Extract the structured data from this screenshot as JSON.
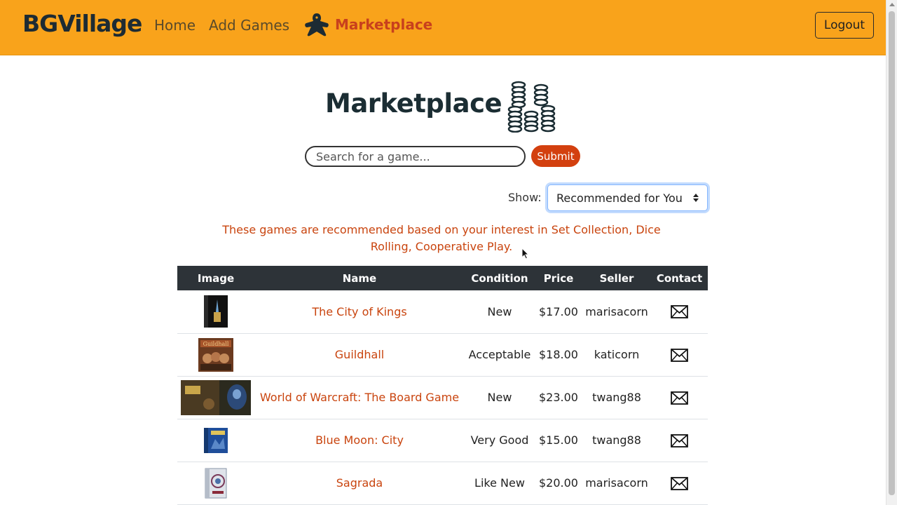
{
  "app": {
    "brand": "BGVillage"
  },
  "nav": {
    "home": "Home",
    "add_games": "Add Games",
    "marketplace": "Marketplace",
    "logout": "Logout",
    "marketplace_icon": "meeple-icon"
  },
  "page": {
    "title": "Marketplace",
    "title_icon": "coin-stacks-icon"
  },
  "search": {
    "placeholder": "Search for a game...",
    "value": "",
    "submit_label": "Submit"
  },
  "filter": {
    "label": "Show:",
    "selected": "Recommended for You"
  },
  "recommendation_note": "These games are recommended based on your interest in Set Collection, Dice Rolling, Cooperative Play.",
  "table": {
    "headers": [
      "Image",
      "Name",
      "Condition",
      "Price",
      "Seller",
      "Contact"
    ],
    "rows": [
      {
        "name": "The City of Kings",
        "condition": "New",
        "price": "$17.00",
        "seller": "marisacorn",
        "contact_icon": "envelope-icon"
      },
      {
        "name": "Guildhall",
        "condition": "Acceptable",
        "price": "$18.00",
        "seller": "katicorn",
        "contact_icon": "envelope-icon"
      },
      {
        "name": "World of Warcraft: The Board Game",
        "condition": "New",
        "price": "$23.00",
        "seller": "twang88",
        "contact_icon": "envelope-icon"
      },
      {
        "name": "Blue Moon: City",
        "condition": "Very Good",
        "price": "$15.00",
        "seller": "twang88",
        "contact_icon": "envelope-icon"
      },
      {
        "name": "Sagrada",
        "condition": "Like New",
        "price": "$20.00",
        "seller": "marisacorn",
        "contact_icon": "envelope-icon"
      }
    ]
  },
  "colors": {
    "navbar": "#f9a31b",
    "accent": "#c9440e",
    "submit": "#d3400f",
    "table_header": "#2d3338",
    "title": "#1b2d33"
  }
}
